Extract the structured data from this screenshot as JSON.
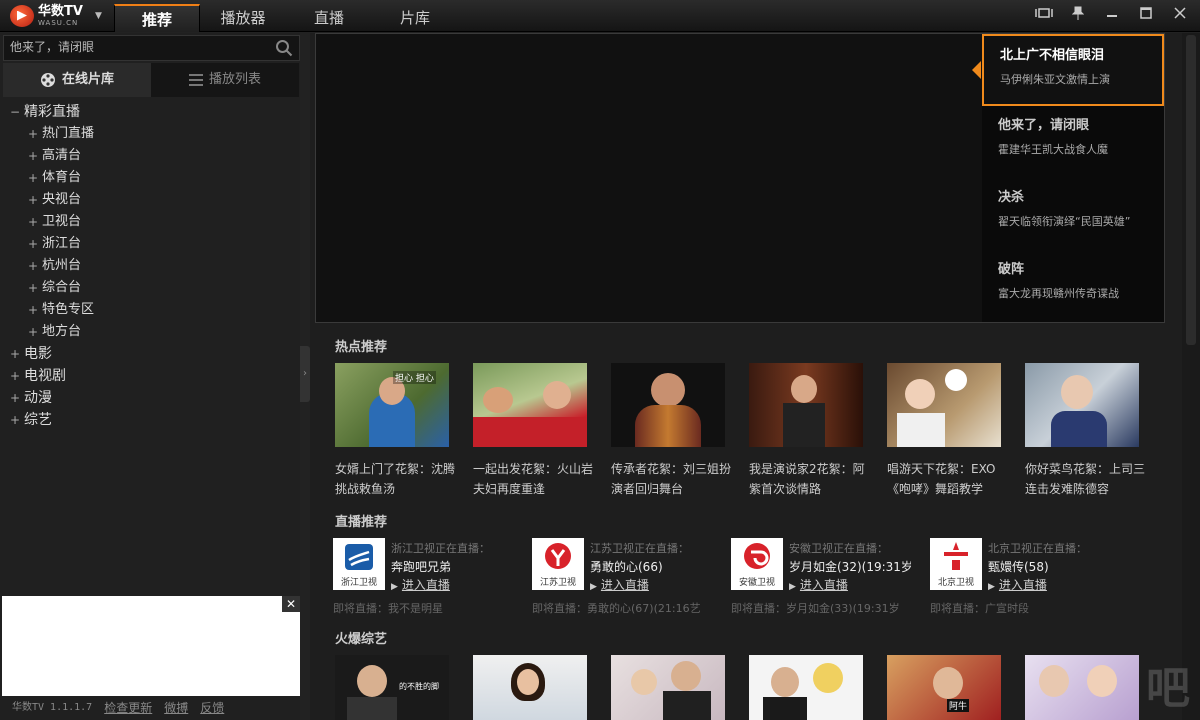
{
  "app": {
    "name": "华数TV",
    "sub": "WASU.CN",
    "version": "华数TV 1.1.1.7"
  },
  "nav": {
    "tabs": [
      "推荐",
      "播放器",
      "直播",
      "片库"
    ]
  },
  "search": {
    "placeholder": "他来了，请闭眼"
  },
  "sidebar": {
    "tabs": [
      "在线片库",
      "播放列表"
    ],
    "tree": {
      "root": "精彩直播",
      "children": [
        "热门直播",
        "高清台",
        "体育台",
        "央视台",
        "卫视台",
        "浙江台",
        "杭州台",
        "综合台",
        "特色专区",
        "地方台"
      ],
      "others": [
        "电影",
        "电视剧",
        "动漫",
        "综艺"
      ]
    },
    "footer": {
      "update": "检查更新",
      "weibo": "微搏",
      "feedback": "反馈"
    }
  },
  "banner": [
    {
      "title": "北上广不相信眼泪",
      "sub": "马伊俐朱亚文激情上演"
    },
    {
      "title": "他来了，请闭眼",
      "sub": "霍建华王凯大战食人魔"
    },
    {
      "title": "决杀",
      "sub": "翟天临领衔演绎“民国英雄”"
    },
    {
      "title": "破阵",
      "sub": "富大龙再现赣州传奇谍战"
    }
  ],
  "hot": {
    "title": "热点推荐",
    "items": [
      {
        "cap": "女婿上门了花絮：沈腾挑战敕鱼汤",
        "overlay": "担心 担心"
      },
      {
        "cap": "一起出发花絮：火山岩夫妇再度重逢",
        "overlay": ""
      },
      {
        "cap": "传承者花絮：刘三姐扮演者回归舞台",
        "overlay": ""
      },
      {
        "cap": "我是演说家2花絮：阿紫首次谈情路",
        "overlay": ""
      },
      {
        "cap": "唱游天下花絮：EXO《咆哮》舞蹈教学",
        "overlay": ""
      },
      {
        "cap": "你好菜鸟花絮：上司三连击发难陈德容",
        "overlay": ""
      }
    ]
  },
  "live": {
    "title": "直播推荐",
    "enter": "进入直播",
    "items": [
      {
        "logo": "浙江卫视",
        "on": "浙江卫视正在直播：",
        "show": "奔跑吧兄弟",
        "next": "即将直播：我不是明星"
      },
      {
        "logo": "江苏卫视",
        "on": "江苏卫视正在直播：",
        "show": "勇敢的心(66)",
        "next": "即将直播：勇敢的心(67)(21:16艺"
      },
      {
        "logo": "安徽卫视",
        "on": "安徽卫视正在直播：",
        "show": "岁月如金(32)(19:31岁",
        "next": "即将直播：岁月如金(33)(19:31岁"
      },
      {
        "logo": "北京卫视",
        "on": "北京卫视正在直播：",
        "show": "甄嬛传(58)",
        "next": "即将直播：广宣时段"
      }
    ]
  },
  "variety": {
    "title": "火爆综艺",
    "overlay": "的不胜的脚",
    "overlay2": "阿牛"
  },
  "watermark": "吧",
  "colors": {
    "accent": "#f08a1c"
  }
}
